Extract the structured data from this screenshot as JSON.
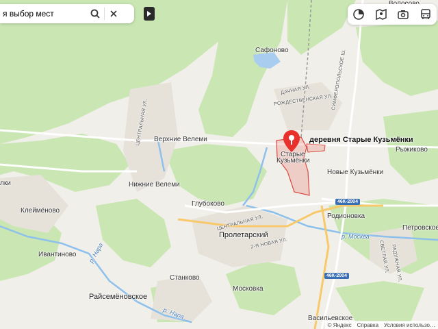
{
  "search": {
    "value": "я выбор мест",
    "search_icon": "search-icon",
    "close_icon": "close-icon"
  },
  "panel": {
    "collapse_icon": "play-icon"
  },
  "layers": [
    "layers-icon",
    "panorama-icon",
    "photo-icon",
    "transit-icon"
  ],
  "place": {
    "name": "деревня Старые Кузьмёнки",
    "pin_color": "#e8312c"
  },
  "labels": {
    "volosovo": "Волосово",
    "safonovo": "Сафоново",
    "dachnaya": "ДАЧНАЯ УЛ.",
    "rozhdestvenskaya": "РОЖДЕСТВЕНСКАЯ УЛ.",
    "simferopolskoe": "СИМФЕРОПОЛЬСКОЕ Ш.",
    "tsentralnaya1": "ЦЕНТРАЛЬНАЯ УЛ.",
    "verkhnie_veleмi": "Верхние Велеми",
    "nizhnie_velemi": "Нижние Велеми",
    "staryе_1": "Старые",
    "staryе_2": "Кузьмёнки",
    "ryzhikovo": "Рыжиково",
    "novye_kuzmenki": "Новые Кузьмёнки",
    "glubokovo": "Глубоково",
    "klemenovo": "Клеймёново",
    "lki": "лки",
    "tsentralnaya2": "ЦЕНТРАЛЬНАЯ УЛ.",
    "proletarsky": "Пролетарский",
    "vtoraya_novaya": "2-Я НОВАЯ УЛ.",
    "rodionovka": "Родионовка",
    "petrovskoe": "Петровское",
    "moskva_river": "р. Москва",
    "svetlaya": "СВЕТЛАЯ УЛ.",
    "raduzhnaya": "РАДУЖНАЯ УЛ.",
    "ivantinovo": "Ивантиново",
    "nara": "р. Нара",
    "staнkovo": "Станково",
    "raisemenovskoe": "Райсемёновское",
    "moskovka": "Московка",
    "vasilevskoe": "Васильевское",
    "nara2": "р. Нара"
  },
  "shields": {
    "road1": "46К-2004",
    "road2": "46К-2004"
  },
  "footer": {
    "brand": "© Яндекс",
    "help": "Справка",
    "terms": "Условия использо…"
  }
}
